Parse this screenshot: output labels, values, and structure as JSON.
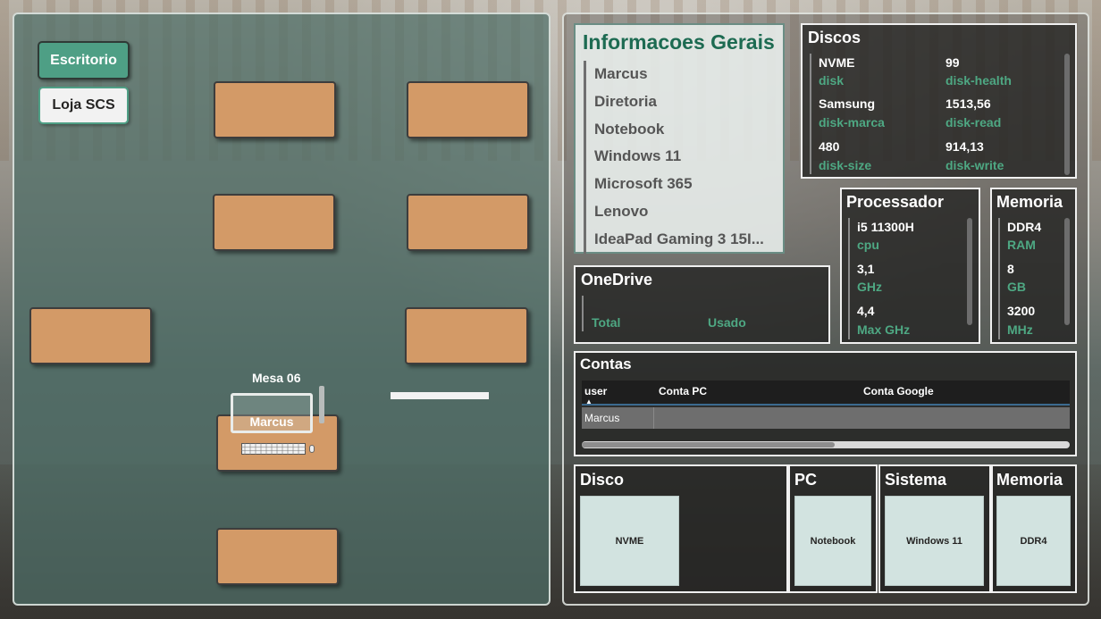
{
  "nav": {
    "buttons": [
      "Escritorio",
      "Loja SCS"
    ]
  },
  "floor_plan": {
    "selected_desk_label": "Mesa 06",
    "monitor_user": "Marcus"
  },
  "info_geral": {
    "title": "Informacoes Gerais",
    "items": [
      "Marcus",
      "Diretoria",
      "Notebook",
      "Windows 11",
      "Microsoft 365",
      "Lenovo",
      "IdeaPad Gaming 3 15I..."
    ]
  },
  "discos": {
    "title": "Discos",
    "rows": [
      {
        "left_value": "NVME",
        "left_label": "disk",
        "right_value": "99",
        "right_label": "disk-health"
      },
      {
        "left_value": "Samsung",
        "left_label": "disk-marca",
        "right_value": "1513,56",
        "right_label": "disk-read"
      },
      {
        "left_value": "480",
        "left_label": "disk-size",
        "right_value": "914,13",
        "right_label": "disk-write"
      }
    ]
  },
  "processador": {
    "title": "Processador",
    "rows": [
      {
        "value": "i5 11300H",
        "label": "cpu"
      },
      {
        "value": "3,1",
        "label": "GHz"
      },
      {
        "value": "4,4",
        "label": "Max GHz"
      }
    ]
  },
  "memoria": {
    "title": "Memoria",
    "rows": [
      {
        "value": "DDR4",
        "label": "RAM"
      },
      {
        "value": "8",
        "label": "GB"
      },
      {
        "value": "3200",
        "label": "MHz"
      }
    ]
  },
  "onedrive": {
    "title": "OneDrive",
    "total_label": "Total",
    "used_label": "Usado"
  },
  "contas": {
    "title": "Contas",
    "columns": [
      "user",
      "Conta PC",
      "Conta Google"
    ],
    "rows": [
      [
        "Marcus",
        "",
        ""
      ]
    ]
  },
  "summary_cards": [
    {
      "title": "Disco",
      "value": "NVME"
    },
    {
      "title": "PC",
      "value": "Notebook"
    },
    {
      "title": "Sistema",
      "value": "Windows 11"
    },
    {
      "title": "Memoria",
      "value": "DDR4"
    }
  ],
  "colors": {
    "accent": "#4e9f85",
    "desk": "#d39a67",
    "info_title": "#1d6b52"
  }
}
